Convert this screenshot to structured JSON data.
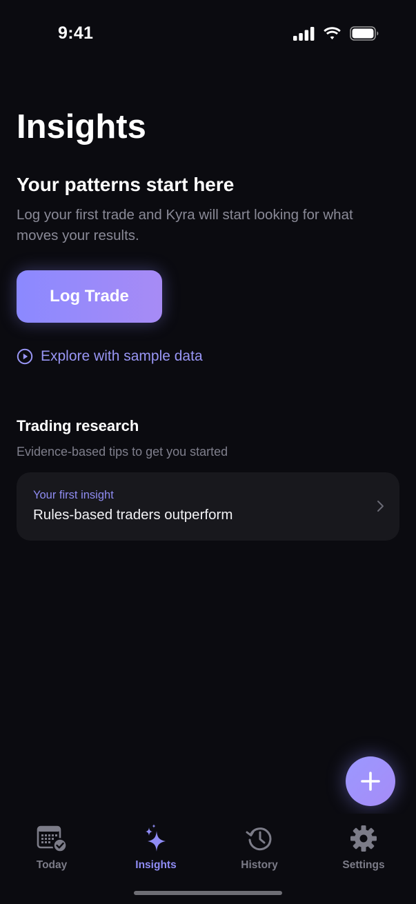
{
  "status_bar": {
    "time": "9:41"
  },
  "header": {
    "title": "Insights"
  },
  "empty_state": {
    "title": "Your patterns start here",
    "description": "Log your first trade and Kyra will start looking for what moves your results.",
    "primary_button": "Log Trade",
    "secondary_link": "Explore with sample data"
  },
  "research": {
    "title": "Trading research",
    "subtitle": "Evidence-based tips to get you started",
    "cards": [
      {
        "eyebrow": "Your first insight",
        "title": "Rules-based traders outperform"
      }
    ]
  },
  "tab_bar": {
    "items": [
      {
        "label": "Today",
        "icon": "calendar-check-icon",
        "active": false
      },
      {
        "label": "Insights",
        "icon": "sparkles-icon",
        "active": true
      },
      {
        "label": "History",
        "icon": "history-clock-icon",
        "active": false
      },
      {
        "label": "Settings",
        "icon": "gear-icon",
        "active": false
      }
    ]
  },
  "colors": {
    "background": "#0b0b10",
    "accent": "#8f8cf5",
    "card": "#18181d",
    "muted_text": "#8a8a97"
  }
}
